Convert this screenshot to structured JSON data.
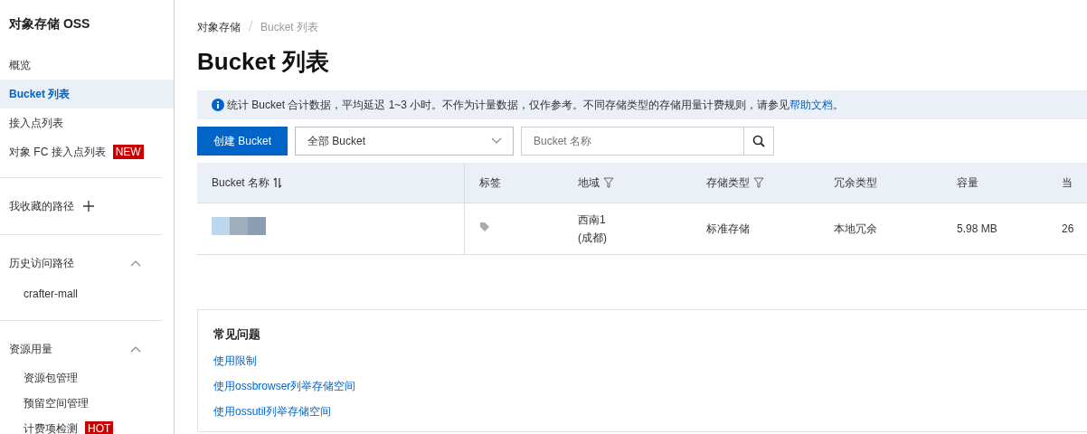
{
  "sidebar": {
    "title": "对象存储 OSS",
    "nav": [
      {
        "label": "概览",
        "selected": false
      },
      {
        "label": "Bucket 列表",
        "selected": true
      },
      {
        "label": "接入点列表",
        "selected": false
      },
      {
        "label": "对象 FC 接入点列表",
        "selected": false,
        "badge": "NEW"
      }
    ],
    "sections": [
      {
        "title": "我收藏的路径",
        "kind": "add"
      },
      {
        "title": "历史访问路径",
        "kind": "collapse",
        "expanded": true,
        "items": [
          {
            "label": "crafter-mall"
          }
        ]
      },
      {
        "title": "资源用量",
        "kind": "collapse",
        "expanded": true,
        "items": [
          {
            "label": "资源包管理"
          },
          {
            "label": "预留空间管理"
          },
          {
            "label": "计费项检测",
            "badge": "HOT"
          }
        ]
      }
    ]
  },
  "breadcrumb": [
    "对象存储",
    "Bucket 列表"
  ],
  "page_title": "Bucket 列表",
  "notice": {
    "text": "统计 Bucket 合计数据，平均延迟 1~3 小时。不作为计量数据，仅作参考。不同存储类型的存储用量计费规则，请参见",
    "link": "帮助文档",
    "end": "。"
  },
  "toolbar": {
    "create_button": "创建 Bucket",
    "filter_value": "全部 Bucket",
    "search_placeholder": "Bucket 名称"
  },
  "table": {
    "columns": [
      {
        "label": "Bucket 名称",
        "kind": "sort"
      },
      {
        "label": "标签",
        "kind": "plain"
      },
      {
        "label": "地域",
        "kind": "filter"
      },
      {
        "label": "存储类型",
        "kind": "filter"
      },
      {
        "label": "冗余类型",
        "kind": "plain"
      },
      {
        "label": "容量",
        "kind": "plain"
      },
      {
        "label": "当",
        "kind": "plain"
      }
    ],
    "rows": [
      {
        "region": "西南1\n(成都)",
        "storage_type": "标准存储",
        "redundancy": "本地冗余",
        "capacity": "5.98 MB",
        "column_7": "26"
      }
    ]
  },
  "faq": {
    "title": "常见问题",
    "links": [
      "使用限制",
      "使用ossbrowser列举存储空间",
      "使用ossutil列举存储空间"
    ]
  }
}
